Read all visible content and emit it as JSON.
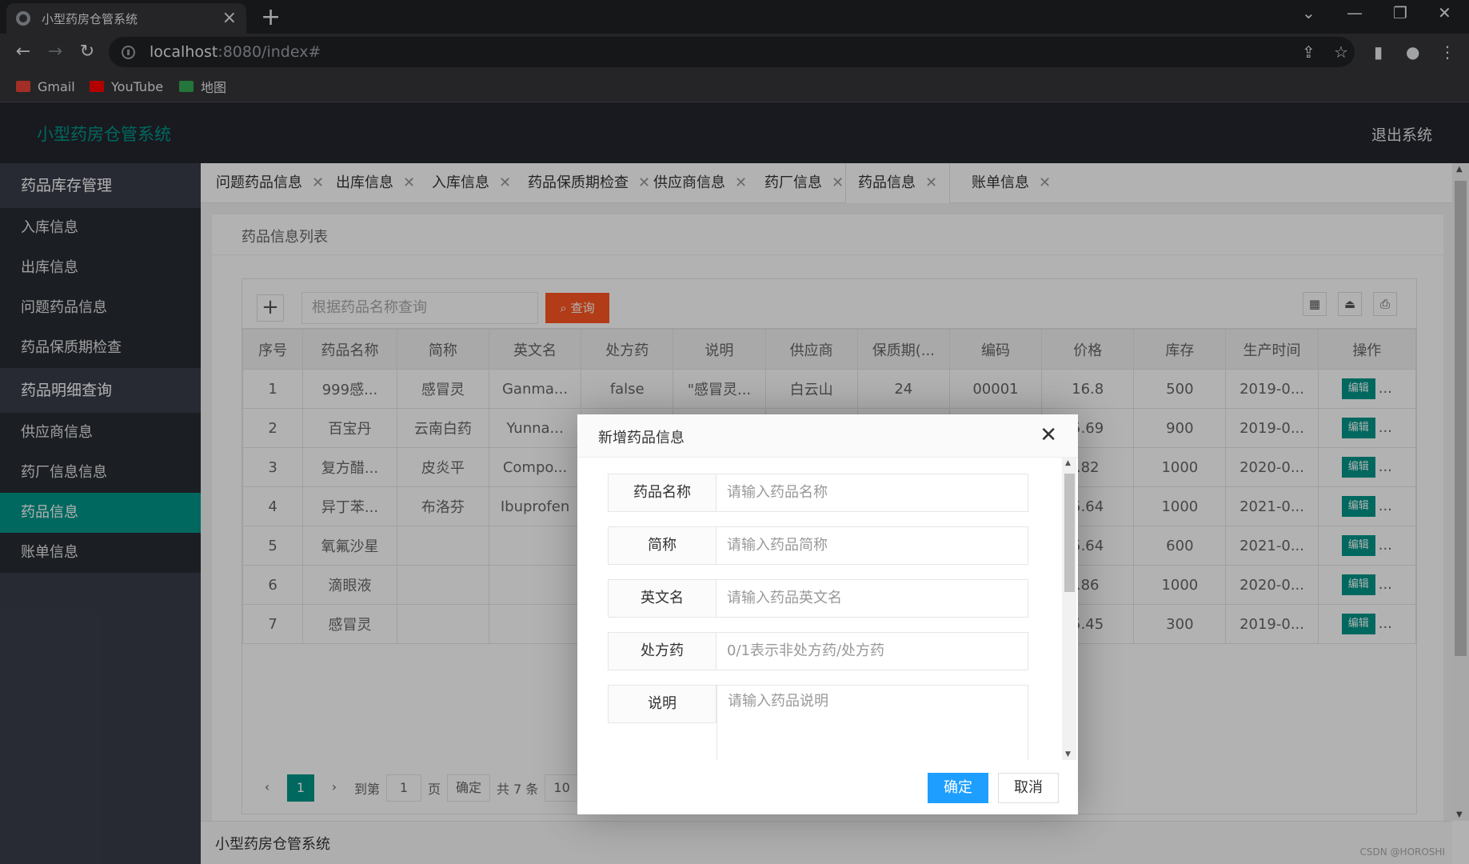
{
  "browser": {
    "tab_title": "小型药房仓管系统",
    "url_host": "localhost",
    "url_rest": ":8080/index#",
    "bookmarks": [
      {
        "label": "Gmail",
        "color": "#ea4335"
      },
      {
        "label": "YouTube",
        "color": "#ff0000"
      },
      {
        "label": "地图",
        "color": "#34a853"
      }
    ]
  },
  "header": {
    "logo": "小型药房仓管系统",
    "logout": "退出系统"
  },
  "sidebar": {
    "groups": [
      {
        "label": "药品库存管理",
        "items": [
          "入库信息",
          "出库信息",
          "问题药品信息",
          "药品保质期检查"
        ]
      },
      {
        "label": "药品明细查询",
        "items": [
          "供应商信息",
          "药厂信息信息",
          "药品信息",
          "账单信息"
        ]
      }
    ],
    "active": "药品信息"
  },
  "tabs": [
    "问题药品信息",
    "出库信息",
    "入库信息",
    "药品保质期检查",
    "供应商信息",
    "药厂信息",
    "药品信息",
    "账单信息"
  ],
  "content": {
    "panel_title": "药品信息列表",
    "search_placeholder": "根据药品名称查询",
    "search_button": "查询",
    "add_icon": "plus-icon",
    "columns": [
      "序号",
      "药品名称",
      "简称",
      "英文名",
      "处方药",
      "说明",
      "供应商",
      "保质期(...",
      "编码",
      "价格",
      "库存",
      "生产时间",
      "操作"
    ],
    "rows": [
      [
        "1",
        "999感...",
        "感冒灵",
        "Ganma...",
        "false",
        "\"感冒灵...",
        "白云山",
        "24",
        "00001",
        "16.8",
        "500",
        "2019-0..."
      ],
      [
        "2",
        "百宝丹",
        "云南白药",
        "Yunna...",
        "",
        "",
        "",
        "",
        "",
        "5.69",
        "900",
        "2019-0..."
      ],
      [
        "3",
        "复方醋...",
        "皮炎平",
        "Compo...",
        "",
        "",
        "",
        "",
        "",
        ".82",
        "1000",
        "2020-0..."
      ],
      [
        "4",
        "异丁苯...",
        "布洛芬",
        "Ibuprofen",
        "",
        "",
        "",
        "",
        "",
        "5.64",
        "1000",
        "2021-0..."
      ],
      [
        "5",
        "氧氟沙星",
        "",
        "",
        "",
        "",
        "",
        "",
        "",
        "5.64",
        "600",
        "2021-0..."
      ],
      [
        "6",
        "滴眼液",
        "",
        "",
        "",
        "",
        "",
        "",
        "",
        ".86",
        "1000",
        "2020-0..."
      ],
      [
        "7",
        "感冒灵",
        "",
        "",
        "",
        "",
        "",
        "",
        "",
        "5.45",
        "300",
        "2019-0..."
      ]
    ],
    "edit_label": "编辑",
    "more_label": "...",
    "pager": {
      "current": "1",
      "goto_label": "到第",
      "goto_value": "1",
      "page_label": "页",
      "confirm": "确定",
      "total": "共 7 条",
      "size": "10"
    }
  },
  "footer": {
    "text": "小型药房仓管系统",
    "watermark": "CSDN @HOROSHI"
  },
  "modal": {
    "title": "新增药品信息",
    "fields": [
      {
        "label": "药品名称",
        "placeholder": "请输入药品名称"
      },
      {
        "label": "简称",
        "placeholder": "请输入药品简称"
      },
      {
        "label": "英文名",
        "placeholder": "请输入药品英文名"
      },
      {
        "label": "处方药",
        "placeholder": "0/1表示非处方药/处方药"
      },
      {
        "label": "说明",
        "placeholder": "请输入药品说明"
      }
    ],
    "ok": "确定",
    "cancel": "取消"
  }
}
